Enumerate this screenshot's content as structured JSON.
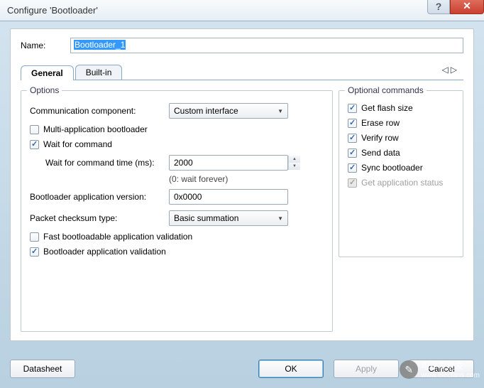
{
  "window": {
    "title": "Configure 'Bootloader'"
  },
  "name": {
    "label": "Name:",
    "value": "Bootloader_1"
  },
  "tabs": {
    "general": "General",
    "builtin": "Built-in",
    "nav_left": "◁",
    "nav_right": "▷"
  },
  "options": {
    "group_title": "Options",
    "comm_component_label": "Communication component:",
    "comm_component_value": "Custom interface",
    "multi_app": {
      "label": "Multi-application bootloader",
      "checked": false
    },
    "wait_cmd": {
      "label": "Wait for command",
      "checked": true
    },
    "wait_time_label": "Wait for command time (ms):",
    "wait_time_value": "2000",
    "wait_time_hint": "(0: wait forever)",
    "app_version_label": "Bootloader application version:",
    "app_version_value": "0x0000",
    "checksum_label": "Packet checksum type:",
    "checksum_value": "Basic summation",
    "fast_validation": {
      "label": "Fast bootloadable application validation",
      "checked": false
    },
    "bootloader_validation": {
      "label": "Bootloader application validation",
      "checked": true
    }
  },
  "optcmds": {
    "group_title": "Optional commands",
    "get_flash_size": {
      "label": "Get flash size",
      "checked": true
    },
    "erase_row": {
      "label": "Erase row",
      "checked": true
    },
    "verify_row": {
      "label": "Verify row",
      "checked": true
    },
    "send_data": {
      "label": "Send data",
      "checked": true
    },
    "sync_bootloader": {
      "label": "Sync bootloader",
      "checked": true
    },
    "get_app_status": {
      "label": "Get application status",
      "checked": true,
      "disabled": true
    }
  },
  "buttons": {
    "datasheet": "Datasheet",
    "ok": "OK",
    "apply": "Apply",
    "cancel": "Cancel"
  },
  "watermark": {
    "text": "电子发烧友",
    "url": "www.elecfans.com",
    "icon": "✎"
  }
}
